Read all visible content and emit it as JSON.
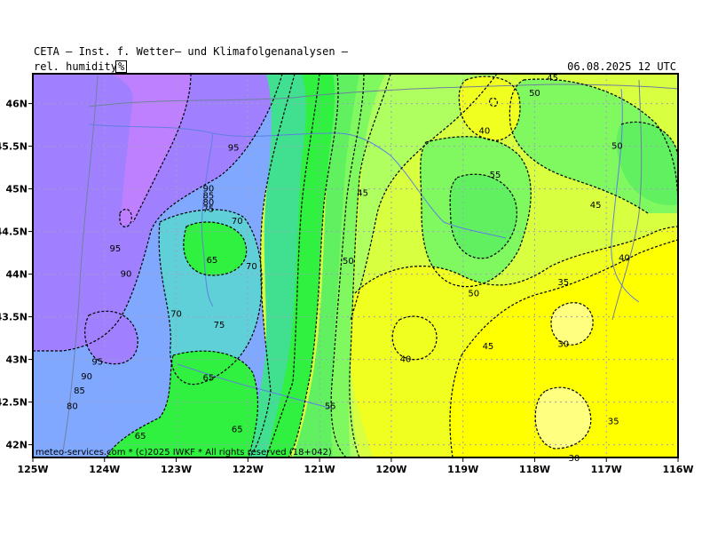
{
  "header": {
    "title": "CETA — Inst. f. Wetter— und Klimafolgenanalysen —",
    "field": "rel. humidity",
    "unit": "%",
    "datetime": "06.08.2025 12 UTC"
  },
  "footer": {
    "copyright": "meteo-services.com * (c)2025 IWKF * All rights reserved (18+042)"
  },
  "colors": {
    "h95": "#bf80ff",
    "h90": "#a080ff",
    "h85": "#8090ff",
    "h80": "#80a8ff",
    "h75": "#60d0d8",
    "h70": "#40e090",
    "h65": "#30f040",
    "h60": "#60f060",
    "h55": "#80f860",
    "h50": "#b0ff60",
    "h45": "#d8ff40",
    "h40": "#f0ff20",
    "h35": "#ffff00",
    "h30": "#ffff80",
    "grid": "#a0a0c0",
    "rivers": "#6080e0",
    "borders": "#7080a0",
    "frame": "#000000"
  },
  "map": {
    "lon_range": [
      -125,
      -116
    ],
    "lat_range": [
      41.85,
      46.35
    ],
    "x_ticks": [
      {
        "lon": -125,
        "label": "125W"
      },
      {
        "lon": -124,
        "label": "124W"
      },
      {
        "lon": -123,
        "label": "123W"
      },
      {
        "lon": -122,
        "label": "122W"
      },
      {
        "lon": -121,
        "label": "121W"
      },
      {
        "lon": -120,
        "label": "120W"
      },
      {
        "lon": -119,
        "label": "119W"
      },
      {
        "lon": -118,
        "label": "118W"
      },
      {
        "lon": -117,
        "label": "117W"
      },
      {
        "lon": -116,
        "label": "116W"
      }
    ],
    "y_ticks": [
      {
        "lat": 46.0,
        "label": "46N"
      },
      {
        "lat": 45.5,
        "label": "45.5N"
      },
      {
        "lat": 45.0,
        "label": "45N"
      },
      {
        "lat": 44.5,
        "label": "44.5N"
      },
      {
        "lat": 44.0,
        "label": "44N"
      },
      {
        "lat": 43.5,
        "label": "43.5N"
      },
      {
        "lat": 43.0,
        "label": "43N"
      },
      {
        "lat": 42.5,
        "label": "42.5N"
      },
      {
        "lat": 42.0,
        "label": "42N"
      }
    ],
    "contour_labels": [
      {
        "lon": -122.2,
        "lat": 45.48,
        "text": "95"
      },
      {
        "lon": -122.55,
        "lat": 45.0,
        "text": "90"
      },
      {
        "lon": -122.55,
        "lat": 44.92,
        "text": "85"
      },
      {
        "lon": -122.55,
        "lat": 44.84,
        "text": "80"
      },
      {
        "lon": -122.55,
        "lat": 44.76,
        "text": "75"
      },
      {
        "lon": -122.15,
        "lat": 44.62,
        "text": "70"
      },
      {
        "lon": -123.85,
        "lat": 44.3,
        "text": "95"
      },
      {
        "lon": -123.7,
        "lat": 44.0,
        "text": "90"
      },
      {
        "lon": -122.5,
        "lat": 44.16,
        "text": "65"
      },
      {
        "lon": -121.95,
        "lat": 44.09,
        "text": "70"
      },
      {
        "lon": -123.0,
        "lat": 43.53,
        "text": "70"
      },
      {
        "lon": -122.4,
        "lat": 43.4,
        "text": "75"
      },
      {
        "lon": -124.1,
        "lat": 42.97,
        "text": "95"
      },
      {
        "lon": -124.25,
        "lat": 42.8,
        "text": "90"
      },
      {
        "lon": -124.35,
        "lat": 42.63,
        "text": "85"
      },
      {
        "lon": -124.45,
        "lat": 42.45,
        "text": "80"
      },
      {
        "lon": -122.55,
        "lat": 42.78,
        "text": "65"
      },
      {
        "lon": -123.5,
        "lat": 42.1,
        "text": "65"
      },
      {
        "lon": -122.15,
        "lat": 42.18,
        "text": "65"
      },
      {
        "lon": -120.85,
        "lat": 42.45,
        "text": "55"
      },
      {
        "lon": -120.4,
        "lat": 44.95,
        "text": "45"
      },
      {
        "lon": -120.6,
        "lat": 44.15,
        "text": "50"
      },
      {
        "lon": -118.85,
        "lat": 43.77,
        "text": "50"
      },
      {
        "lon": -118.55,
        "lat": 45.16,
        "text": "55"
      },
      {
        "lon": -118.7,
        "lat": 45.68,
        "text": "40"
      },
      {
        "lon": -118.0,
        "lat": 46.12,
        "text": "50"
      },
      {
        "lon": -117.75,
        "lat": 46.3,
        "text": "45"
      },
      {
        "lon": -116.85,
        "lat": 45.5,
        "text": "50"
      },
      {
        "lon": -117.15,
        "lat": 44.81,
        "text": "45"
      },
      {
        "lon": -116.75,
        "lat": 44.19,
        "text": "40"
      },
      {
        "lon": -117.6,
        "lat": 43.9,
        "text": "35"
      },
      {
        "lon": -117.6,
        "lat": 43.18,
        "text": "30"
      },
      {
        "lon": -118.65,
        "lat": 43.15,
        "text": "45"
      },
      {
        "lon": -119.8,
        "lat": 43.0,
        "text": "40"
      },
      {
        "lon": -116.9,
        "lat": 42.27,
        "text": "35"
      },
      {
        "lon": -117.45,
        "lat": 41.84,
        "text": "30"
      }
    ]
  }
}
